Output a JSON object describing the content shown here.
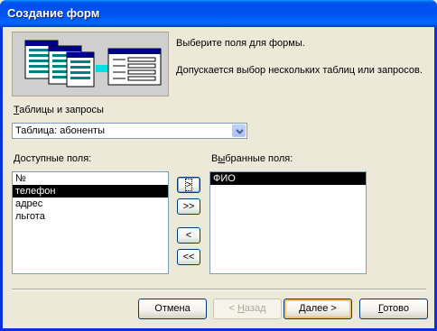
{
  "window": {
    "title": "Создание форм"
  },
  "intro": {
    "line1": "Выберите поля для формы.",
    "line2": "Допускается выбор нескольких таблиц или запросов."
  },
  "tables": {
    "label_accel": "Т",
    "label_rest": "аблицы и запросы",
    "selected": "Таблица: абоненты"
  },
  "available": {
    "label_accel": "Д",
    "label_rest": "оступные поля:",
    "items": [
      "№",
      "телефон",
      "адрес",
      "льгота"
    ],
    "selected_item": "телефон"
  },
  "chosen": {
    "label_pre": "В",
    "label_accel": "ы",
    "label_rest": "бранные поля:",
    "items": [
      "ФИО"
    ]
  },
  "move_buttons": {
    "add_one": ">",
    "add_all": ">>",
    "remove_one": "<",
    "remove_all": "<<"
  },
  "footer": {
    "cancel": "Отмена",
    "back_accel": "Н",
    "back_pre": "< ",
    "back_rest": "азад",
    "next_accel": "Д",
    "next_rest": "алее >",
    "finish_accel": "Г",
    "finish_rest": "отово"
  },
  "colors": {
    "titlebar": "#0053ee",
    "selection": "#000000",
    "dialog_bg": "#ece9d8"
  },
  "icons": {
    "banner": "form-wizard-illustration",
    "dropdown": "chevron-down-icon"
  }
}
